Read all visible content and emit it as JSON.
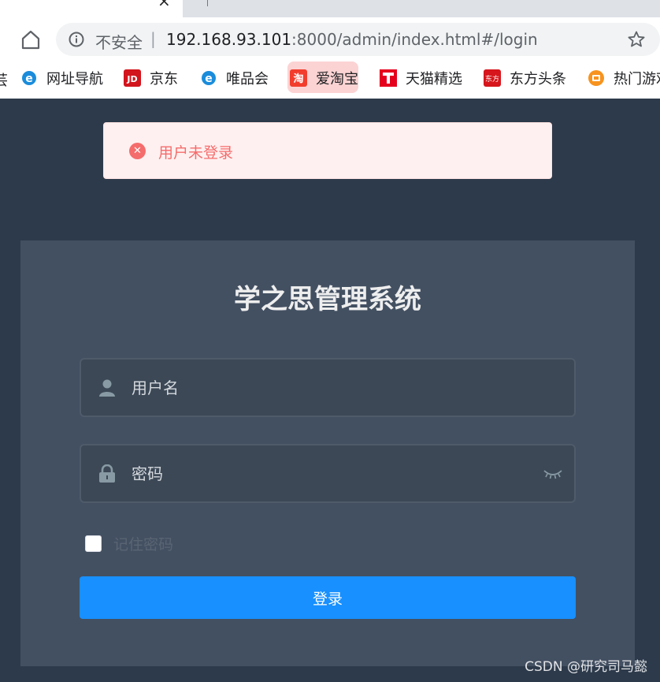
{
  "browser": {
    "tab_close_symbol": "×",
    "security_label": "不安全",
    "url_separator": "|",
    "url_host": "192.168.93.101",
    "url_rest": ":8000/admin/index.html#/login",
    "bookmarks_cut_text": "芸",
    "bookmarks": [
      {
        "label": "网址导航",
        "icon": "ie-e-icon",
        "color": "#1a8cdb"
      },
      {
        "label": "京东",
        "icon": "jd-icon",
        "color": "#d2141c"
      },
      {
        "label": "唯品会",
        "icon": "ie-e-icon",
        "color": "#1a8cdb"
      },
      {
        "label": "爱淘宝",
        "icon": "taobao-icon",
        "color": "#f23d2d"
      },
      {
        "label": "天猫精选",
        "icon": "tmall-icon",
        "color": "#e5001d"
      },
      {
        "label": "东方头条",
        "icon": "dftt-icon",
        "color": "#d6161c"
      },
      {
        "label": "热门游戏",
        "icon": "game-icon",
        "color": "#f7931e"
      }
    ]
  },
  "alert": {
    "message": "用户未登录",
    "icon_symbol": "✕",
    "color": "#f56c6c"
  },
  "login": {
    "title": "学之思管理系统",
    "username_placeholder": "用户名",
    "password_placeholder": "密码",
    "remember_label": "记住密码",
    "submit_label": "登录",
    "accent": "#1890ff"
  },
  "watermark": "CSDN @研究司马懿"
}
